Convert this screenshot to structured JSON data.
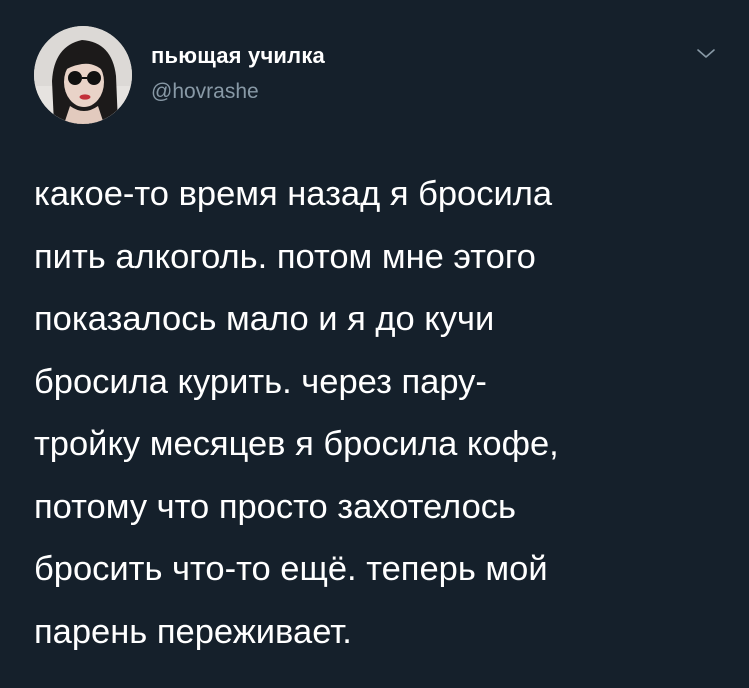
{
  "tweet": {
    "author": {
      "display_name": "пьющая училка",
      "handle": "@hovrashe",
      "avatar_icon": "profile-photo"
    },
    "menu_icon": "chevron-down-icon",
    "text": "какое-то время назад я бросила\nпить алкоголь. потом мне этого\nпоказалось мало и я до кучи\nбросила курить. через пару-\nтройку месяцев я бросила кофе,\nпотому что просто захотелось\nбросить что-то ещё. теперь мой\nпарень переживает."
  },
  "colors": {
    "background": "#15202b",
    "text": "#ffffff",
    "secondary_text": "#8899a6"
  }
}
